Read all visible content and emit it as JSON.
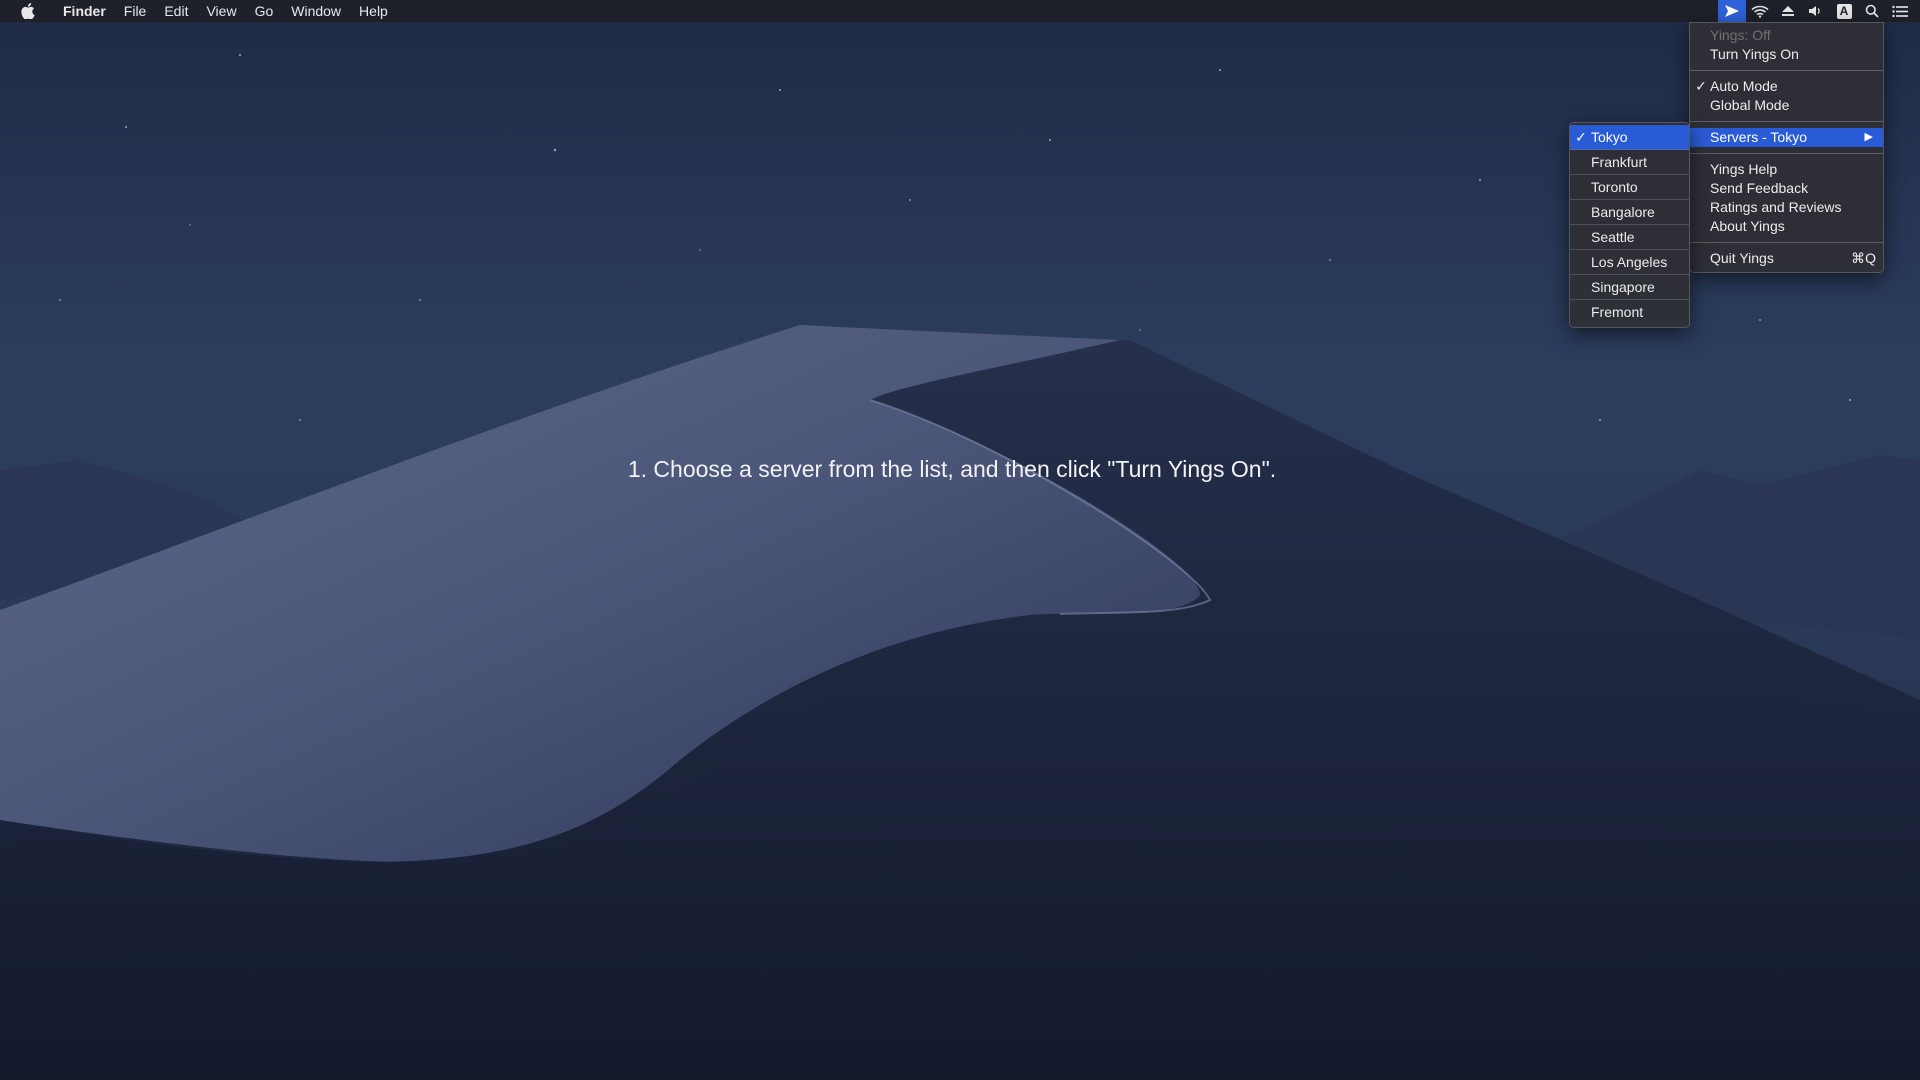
{
  "menubar": {
    "apple_icon": "apple-logo-icon",
    "app_name": "Finder",
    "items": [
      "File",
      "Edit",
      "View",
      "Go",
      "Window",
      "Help"
    ],
    "status_icons": [
      "yings-arrow-icon",
      "wifi-icon",
      "eject-icon",
      "volume-icon",
      "input-source-icon",
      "search-icon",
      "notification-center-icon"
    ],
    "input_source_label": "A"
  },
  "instruction": "1. Choose a server from the list, and then click \"Turn Yings On\".",
  "yings_menu": {
    "status": "Yings: Off",
    "turn_on": "Turn Yings On",
    "auto_mode": "Auto Mode",
    "auto_mode_checked": true,
    "global_mode": "Global Mode",
    "servers": "Servers - Tokyo",
    "help": "Yings Help",
    "feedback": "Send Feedback",
    "ratings": "Ratings and Reviews",
    "about": "About Yings",
    "quit": "Quit Yings",
    "quit_shortcut": "⌘Q"
  },
  "servers_submenu": {
    "selected": "Tokyo",
    "items": [
      "Tokyo",
      "Frankfurt",
      "Toronto",
      "Bangalore",
      "Seattle",
      "Los Angeles",
      "Singapore",
      "Fremont"
    ]
  },
  "colors": {
    "menu_highlight": "#2a5bd7",
    "menubar_bg": "#1e2128",
    "menu_bg": "#2e3036"
  }
}
